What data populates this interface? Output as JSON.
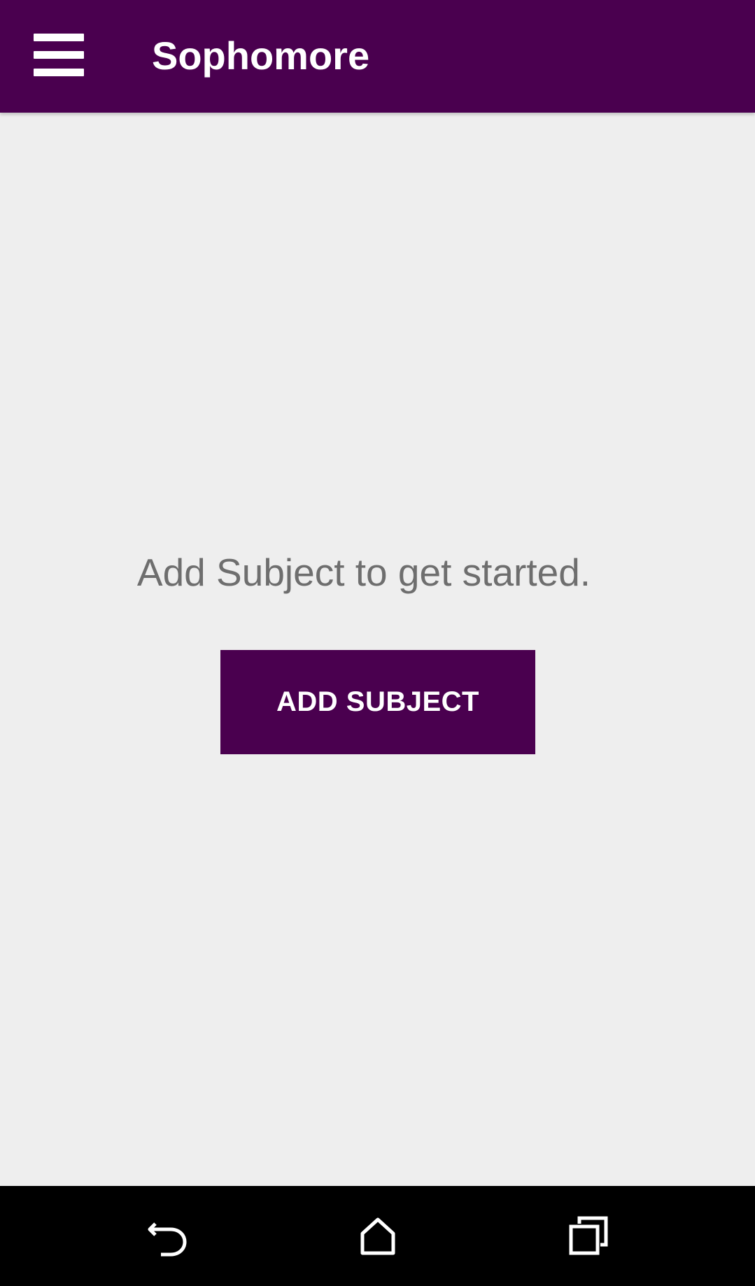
{
  "app_bar": {
    "menu_icon": "hamburger-menu-icon",
    "title": "Sophomore",
    "background_color": "#4a004f"
  },
  "main": {
    "empty_message": "Add Subject to get started.",
    "add_button_label": "ADD SUBJECT",
    "button_color": "#4a004f"
  },
  "nav_bar": {
    "back_icon": "back-icon",
    "home_icon": "home-icon",
    "recents_icon": "recents-icon"
  }
}
